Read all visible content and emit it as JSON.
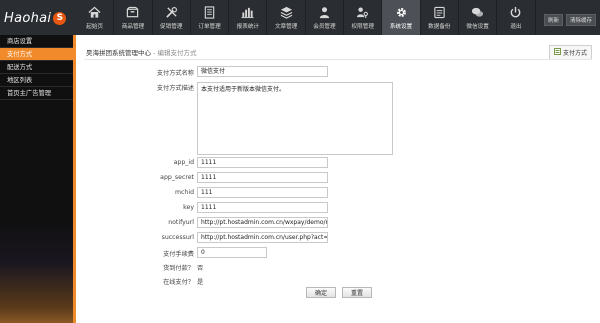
{
  "brand": {
    "logo_text": "Haohai",
    "logo_badge": "S"
  },
  "nav": [
    {
      "label": "起始页",
      "icon": "home-icon"
    },
    {
      "label": "商品管理",
      "icon": "box-icon"
    },
    {
      "label": "促销管理",
      "icon": "tools-icon"
    },
    {
      "label": "订单管理",
      "icon": "document-icon"
    },
    {
      "label": "报表统计",
      "icon": "bar-chart-icon"
    },
    {
      "label": "文章管理",
      "icon": "layers-icon"
    },
    {
      "label": "会员管理",
      "icon": "user-icon"
    },
    {
      "label": "权限管理",
      "icon": "user-key-icon"
    },
    {
      "label": "系统设置",
      "icon": "gear-icon"
    },
    {
      "label": "数据备份",
      "icon": "database-icon"
    },
    {
      "label": "微信设置",
      "icon": "chat-icon"
    },
    {
      "label": "退出",
      "icon": "power-icon"
    }
  ],
  "active_nav_index": 8,
  "top_buttons": {
    "refresh": "刷新",
    "clear_cache": "清除缓存"
  },
  "sidebar": {
    "items": [
      {
        "label": "商店设置"
      },
      {
        "label": "支付方式"
      },
      {
        "label": "配送方式"
      },
      {
        "label": "地区列表"
      },
      {
        "label": "首页主广告管理"
      }
    ],
    "active_index": 1
  },
  "page": {
    "breadcrumb_main": "昊海拼团系统管理中心",
    "breadcrumb_sep": " - ",
    "breadcrumb_sub": "编辑支付方式",
    "action_button": "支付方式"
  },
  "form": {
    "name_label": "支付方式名称",
    "name_value": "微信支付",
    "desc_label": "支付方式描述",
    "desc_value": "本支付适用于新版本微信支付。",
    "app_id_label": "app_id",
    "app_id_value": "1111",
    "app_secret_label": "app_secret",
    "app_secret_value": "1111",
    "mchid_label": "mchid",
    "mchid_value": "111",
    "key_label": "key",
    "key_value": "1111",
    "notifyurl_label": "notifyurl",
    "notifyurl_value": "http://pt.hostadmin.com.cn/wxpay/demo/no",
    "successurl_label": "successurl",
    "successurl_value": "http://pt.hostadmin.com.cn/user.php?act=o",
    "fee_label": "支付手续费",
    "fee_value": "0",
    "cod_label": "货到付款？",
    "cod_value": "否",
    "online_label": "在线支付？",
    "online_value": "是",
    "submit_label": "确定",
    "reset_label": "重置"
  },
  "colors": {
    "accent": "#f08a2a",
    "topbar": "#2a2d31",
    "sidebar": "#101010"
  }
}
